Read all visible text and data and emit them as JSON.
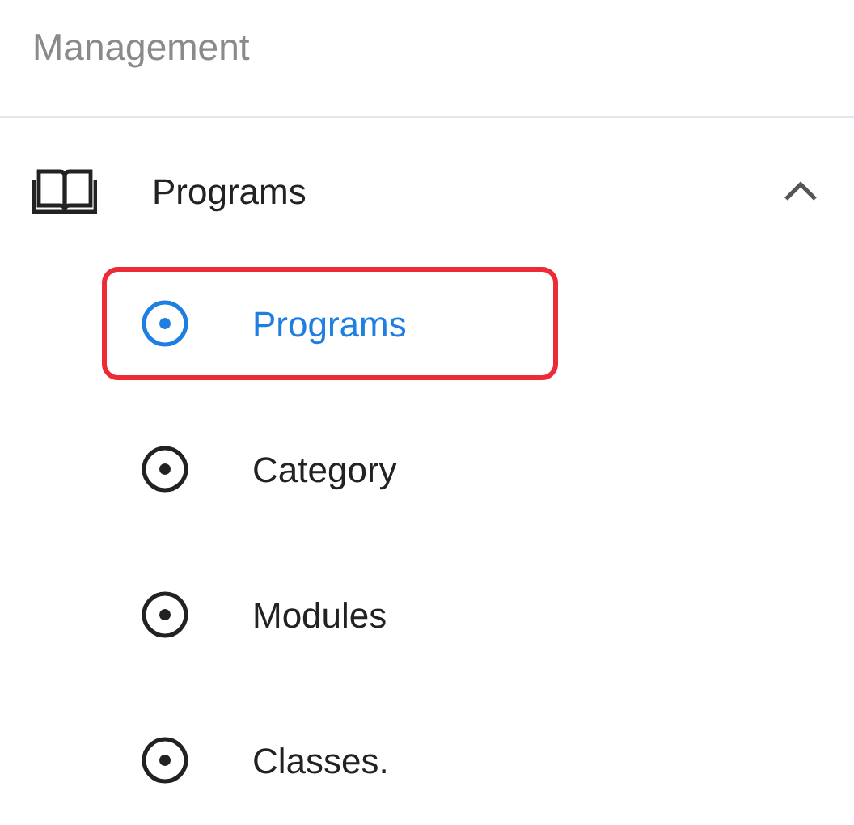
{
  "section_title": "Management",
  "group": {
    "label": "Programs",
    "expanded": true,
    "children": [
      {
        "label": "Programs",
        "selected": true,
        "highlighted": true
      },
      {
        "label": "Category",
        "selected": false,
        "highlighted": false
      },
      {
        "label": "Modules",
        "selected": false,
        "highlighted": false
      },
      {
        "label": "Classes.",
        "selected": false,
        "highlighted": false
      }
    ]
  }
}
